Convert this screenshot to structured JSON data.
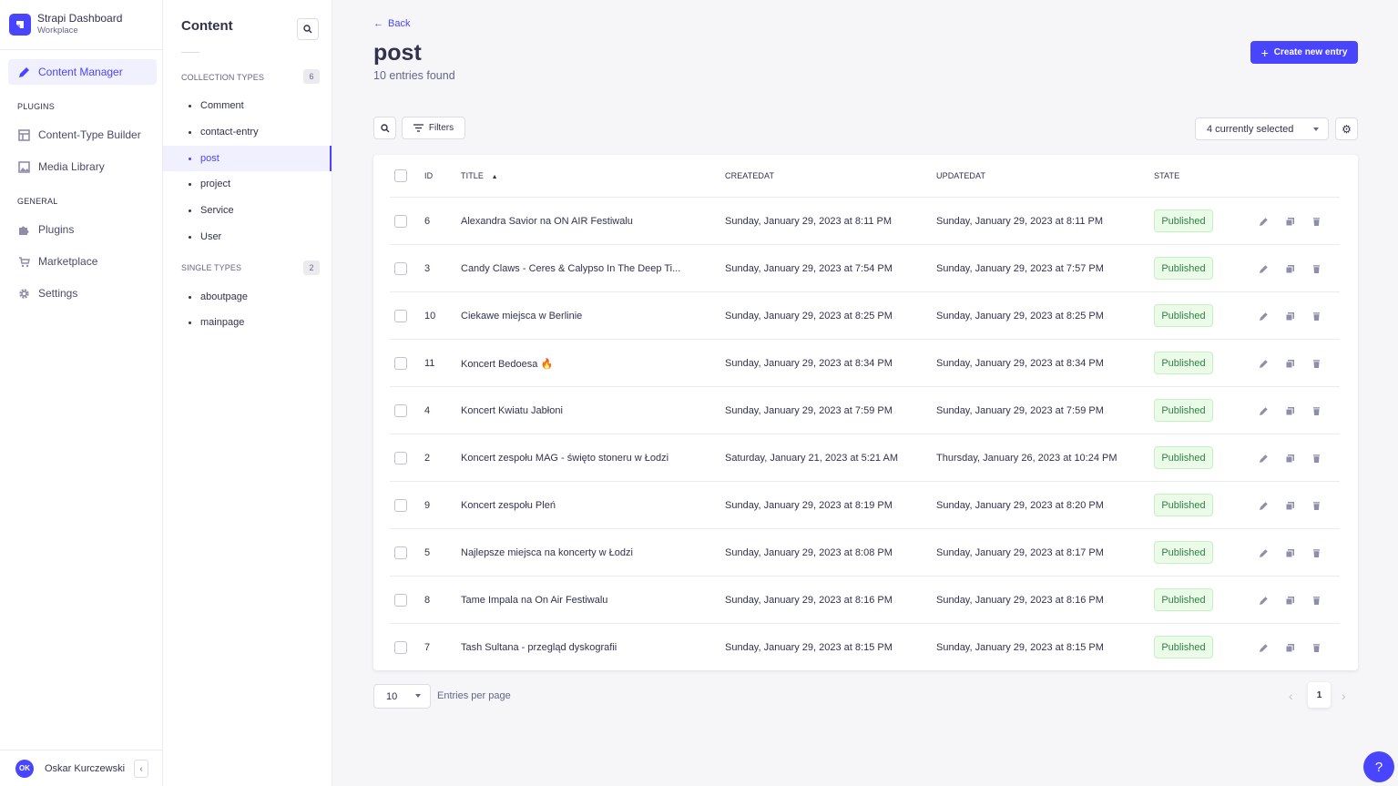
{
  "brand": {
    "title": "Strapi Dashboard",
    "subtitle": "Workplace"
  },
  "mainnav": {
    "content_manager": "Content Manager",
    "plugins_section": "PLUGINS",
    "content_type_builder": "Content-Type Builder",
    "media_library": "Media Library",
    "general_section": "GENERAL",
    "plugins": "Plugins",
    "marketplace": "Marketplace",
    "settings": "Settings"
  },
  "user": {
    "initials": "OK",
    "name": "Oskar Kurczewski"
  },
  "subnav": {
    "title": "Content",
    "collection_section": "COLLECTION TYPES",
    "collection_count": "6",
    "collection_items": [
      "Comment",
      "contact-entry",
      "post",
      "project",
      "Service",
      "User"
    ],
    "single_section": "SINGLE TYPES",
    "single_count": "2",
    "single_items": [
      "aboutpage",
      "mainpage"
    ]
  },
  "header": {
    "back": "Back",
    "title": "post",
    "subtitle": "10 entries found",
    "create_button": "Create new entry"
  },
  "toolbar": {
    "filters": "Filters",
    "columns_select": "4 currently selected"
  },
  "table": {
    "columns": [
      "ID",
      "TITLE",
      "CREATEDAT",
      "UPDATEDAT",
      "STATE"
    ],
    "rows": [
      {
        "id": "6",
        "title": "Alexandra Savior na ON AIR Festiwalu",
        "created": "Sunday, January 29, 2023 at 8:11 PM",
        "updated": "Sunday, January 29, 2023 at 8:11 PM",
        "state": "Published"
      },
      {
        "id": "3",
        "title": "Candy Claws - Ceres & Calypso In The Deep Ti...",
        "created": "Sunday, January 29, 2023 at 7:54 PM",
        "updated": "Sunday, January 29, 2023 at 7:57 PM",
        "state": "Published"
      },
      {
        "id": "10",
        "title": "Ciekawe miejsca w Berlinie",
        "created": "Sunday, January 29, 2023 at 8:25 PM",
        "updated": "Sunday, January 29, 2023 at 8:25 PM",
        "state": "Published"
      },
      {
        "id": "11",
        "title": "Koncert Bedoesa 🔥",
        "created": "Sunday, January 29, 2023 at 8:34 PM",
        "updated": "Sunday, January 29, 2023 at 8:34 PM",
        "state": "Published"
      },
      {
        "id": "4",
        "title": "Koncert Kwiatu Jabłoni",
        "created": "Sunday, January 29, 2023 at 7:59 PM",
        "updated": "Sunday, January 29, 2023 at 7:59 PM",
        "state": "Published"
      },
      {
        "id": "2",
        "title": "Koncert zespołu MAG - święto stoneru w Łodzi",
        "created": "Saturday, January 21, 2023 at 5:21 AM",
        "updated": "Thursday, January 26, 2023 at 10:24 PM",
        "state": "Published"
      },
      {
        "id": "9",
        "title": "Koncert zespołu Pleń",
        "created": "Sunday, January 29, 2023 at 8:19 PM",
        "updated": "Sunday, January 29, 2023 at 8:20 PM",
        "state": "Published"
      },
      {
        "id": "5",
        "title": "Najlepsze miejsca na koncerty w Łodzi",
        "created": "Sunday, January 29, 2023 at 8:08 PM",
        "updated": "Sunday, January 29, 2023 at 8:17 PM",
        "state": "Published"
      },
      {
        "id": "8",
        "title": "Tame Impala na On Air Festiwalu",
        "created": "Sunday, January 29, 2023 at 8:16 PM",
        "updated": "Sunday, January 29, 2023 at 8:16 PM",
        "state": "Published"
      },
      {
        "id": "7",
        "title": "Tash Sultana - przegląd dyskografii",
        "created": "Sunday, January 29, 2023 at 8:15 PM",
        "updated": "Sunday, January 29, 2023 at 8:15 PM",
        "state": "Published"
      }
    ]
  },
  "pagination": {
    "per_page": "10",
    "per_page_label": "Entries per page",
    "current_page": "1"
  },
  "help": "?",
  "colors": {
    "accent": "#4945ff",
    "success_bg": "#eafbe7",
    "success_text": "#328048"
  }
}
